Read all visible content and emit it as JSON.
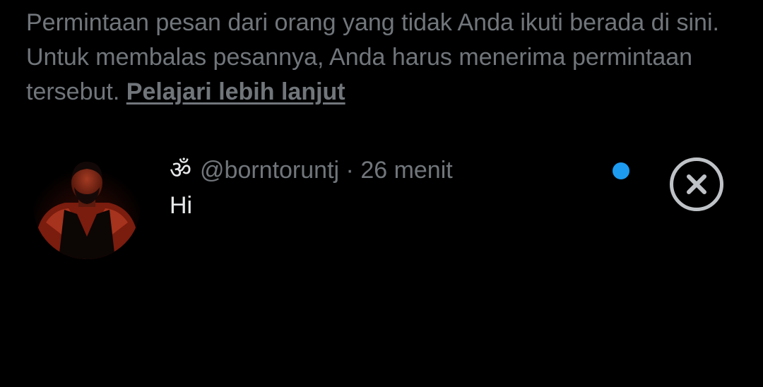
{
  "notice": {
    "text": "Permintaan pesan dari orang yang tidak Anda ikuti berada di sini. Untuk membalas pesannya, Anda harus menerima permintaan tersebut.",
    "learn_more": "Pelajari lebih lanjut"
  },
  "request": {
    "display_name": "ॐ",
    "handle": "@borntoruntj",
    "separator": "·",
    "time": "26 menit",
    "message": "Hi",
    "unread_color": "#1d9bf0"
  },
  "icons": {
    "close": "close-circle-icon",
    "avatar": "user-avatar"
  },
  "colors": {
    "background": "#000000",
    "secondary_text": "#71767b",
    "primary_text": "#e7e9ea",
    "accent": "#1d9bf0"
  }
}
